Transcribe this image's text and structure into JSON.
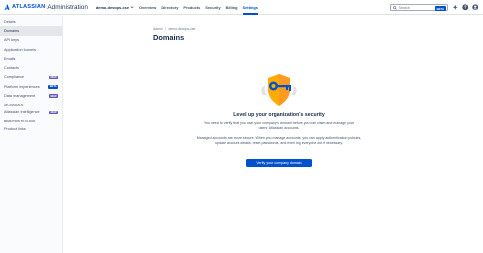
{
  "app": {
    "brand": "ATLASSIAN",
    "product": "Administration",
    "brand_color": "#0052cc"
  },
  "nav": {
    "org": "demo-devops-cse",
    "items": [
      "Overview",
      "Directory",
      "Products",
      "Security",
      "Billing",
      "Settings"
    ],
    "active": "Settings"
  },
  "search": {
    "placeholder": "Search",
    "badge": "BETA"
  },
  "sidebar": {
    "items": [
      {
        "label": "Details"
      },
      {
        "label": "Domains",
        "active": true
      },
      {
        "label": "API keys"
      },
      {
        "label": "Application tunnels"
      },
      {
        "label": "Emails"
      },
      {
        "label": "Contacts"
      },
      {
        "label": "Compliance",
        "tag": "NEW"
      },
      {
        "label": "Platform experiences",
        "tag": "BETA"
      },
      {
        "label": "Data management",
        "tag": "NEW"
      }
    ],
    "section_ai": {
      "heading": "ATLASSIAN AI",
      "items": [
        {
          "label": "Atlassian Intelligence",
          "tag": "NEW"
        }
      ]
    },
    "section_migration": {
      "heading": "MIGRATION TO CLOUD",
      "items": [
        {
          "label": "Product links"
        }
      ]
    }
  },
  "main": {
    "breadcrumb": [
      "Admin",
      "demo-devops-cse"
    ],
    "breadcrumb_sep": "/",
    "title": "Domains",
    "hero_title": "Level up your organization's security",
    "hero_desc": "You need to verify that you own your company's domain before you can claim and manage your users' Atlassian accounts.",
    "hero_desc2": "Managed accounts are more secure. When you manage accounts, you can apply authentication policies, update account details, reset passwords, and even log everyone out if necessary.",
    "cta": "Verify your company domain"
  }
}
